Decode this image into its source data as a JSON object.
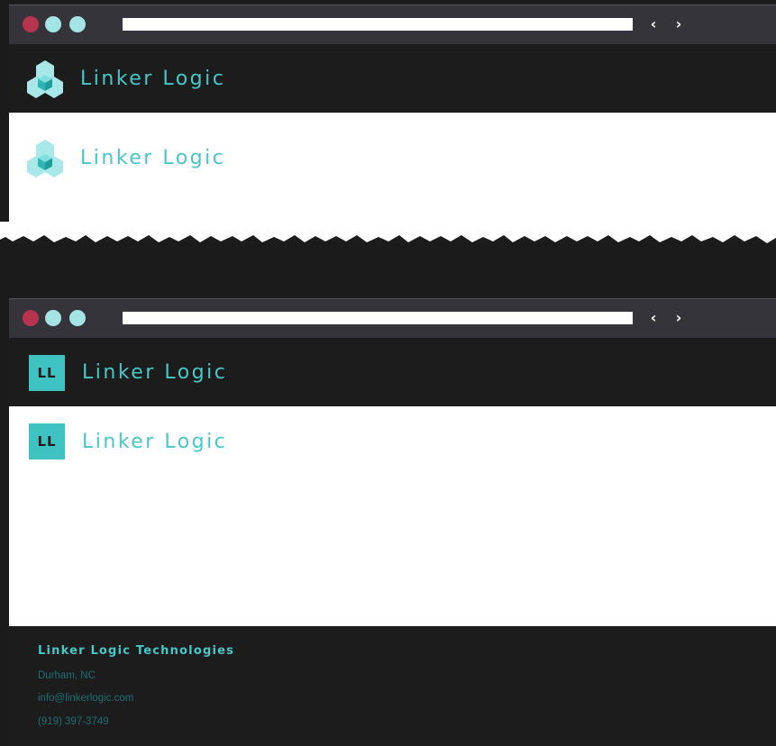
{
  "brand": {
    "name": "Linker Logic",
    "monogram": "LL",
    "accent_color": "#46c8c8",
    "dark_bg": "#1c1c1c",
    "light_bg": "#ffffff"
  },
  "browser_chrome": {
    "close_color": "#b8334d",
    "min_color": "#a4e4e4",
    "max_color": "#a4e4e4",
    "back_glyph": "‹",
    "forward_glyph": "›"
  },
  "window_1": {
    "header_logo": {
      "icon": "cube-cluster-icon",
      "text": "Linker Logic"
    },
    "body_logo": {
      "icon": "cube-cluster-icon",
      "text": "Linker Logic"
    }
  },
  "window_2": {
    "header_logo": {
      "icon": "monogram-badge",
      "text": "Linker Logic"
    },
    "body_logo": {
      "icon": "monogram-badge",
      "text": "Linker Logic"
    },
    "footer": {
      "company": "Linker Logic Technologies",
      "location": "Durham, NC",
      "email": "info@linkerlogic.com",
      "phone": "(919) 397-3749"
    }
  }
}
